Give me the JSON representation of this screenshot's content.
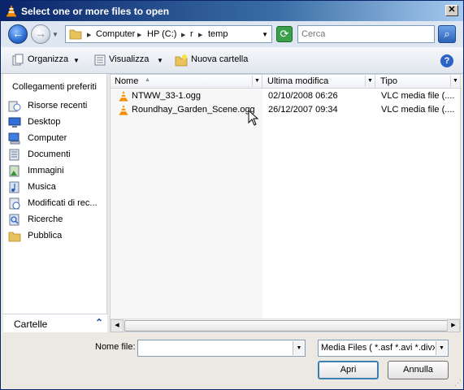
{
  "window": {
    "title": "Select one or more files to open"
  },
  "address": {
    "crumbs": [
      "Computer",
      "HP (C:)",
      "r",
      "temp"
    ]
  },
  "search": {
    "placeholder": "Cerca"
  },
  "toolbar": {
    "organize_label": "Organizza",
    "views_label": "Visualizza",
    "new_folder_label": "Nuova cartella"
  },
  "nav": {
    "header": "Collegamenti preferiti",
    "items": [
      {
        "label": "Risorse recenti",
        "icon": "recent-places-icon"
      },
      {
        "label": "Desktop",
        "icon": "desktop-icon"
      },
      {
        "label": "Computer",
        "icon": "computer-icon"
      },
      {
        "label": "Documenti",
        "icon": "documents-icon"
      },
      {
        "label": "Immagini",
        "icon": "pictures-icon"
      },
      {
        "label": "Musica",
        "icon": "music-icon"
      },
      {
        "label": "Modificati di rec...",
        "icon": "recently-changed-icon"
      },
      {
        "label": "Ricerche",
        "icon": "searches-icon"
      },
      {
        "label": "Pubblica",
        "icon": "public-folder-icon"
      }
    ],
    "folders_label": "Cartelle"
  },
  "filelist": {
    "columns": [
      "Nome",
      "Ultima modifica",
      "Tipo"
    ],
    "rows": [
      {
        "name": "NTWW_33-1.ogg",
        "modified": "02/10/2008 06:26",
        "type": "VLC media file (...."
      },
      {
        "name": "Roundhay_Garden_Scene.ogg",
        "modified": "26/12/2007 09:34",
        "type": "VLC media file (...."
      }
    ]
  },
  "bottom": {
    "filename_label": "Nome file:",
    "filename_value": "",
    "filter_value": "Media Files ( *.asf *.avi *.divx",
    "open_label": "Apri",
    "cancel_label": "Annulla"
  },
  "colors": {
    "title_bar": "#0a246a",
    "accent": "#2b63c6",
    "vlc_orange": "#f28c00"
  }
}
